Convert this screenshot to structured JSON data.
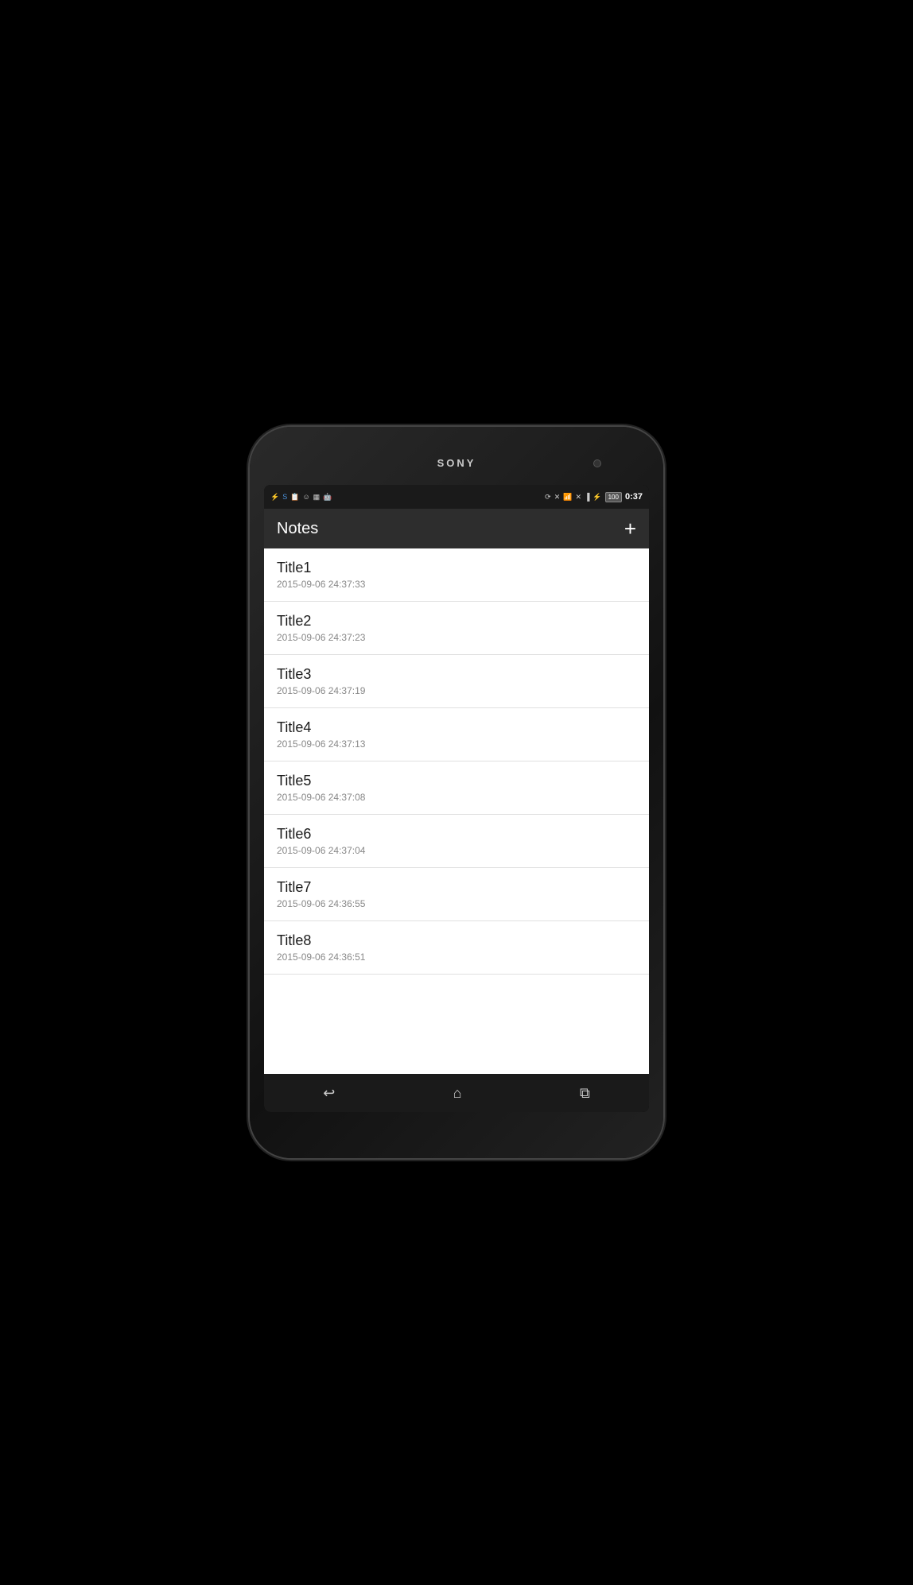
{
  "phone": {
    "brand": "SONY"
  },
  "status_bar": {
    "time": "0:37",
    "battery": "100",
    "icons_left": [
      "USB",
      "S",
      "📋",
      "☺",
      "100",
      "🤖"
    ],
    "icons_right": [
      "rotate",
      "file-x",
      "wifi",
      "signal-x",
      "signal",
      "charge"
    ]
  },
  "app": {
    "title": "Notes",
    "add_button_label": "+"
  },
  "notes": [
    {
      "title": "Title1",
      "date": "2015-09-06 24:37:33"
    },
    {
      "title": "Title2",
      "date": "2015-09-06 24:37:23"
    },
    {
      "title": "Title3",
      "date": "2015-09-06 24:37:19"
    },
    {
      "title": "Title4",
      "date": "2015-09-06 24:37:13"
    },
    {
      "title": "Title5",
      "date": "2015-09-06 24:37:08"
    },
    {
      "title": "Title6",
      "date": "2015-09-06 24:37:04"
    },
    {
      "title": "Title7",
      "date": "2015-09-06 24:36:55"
    },
    {
      "title": "Title8",
      "date": "2015-09-06 24:36:51"
    }
  ],
  "bottom_nav": {
    "back_label": "↩",
    "home_label": "⌂",
    "recents_label": "⧉"
  }
}
